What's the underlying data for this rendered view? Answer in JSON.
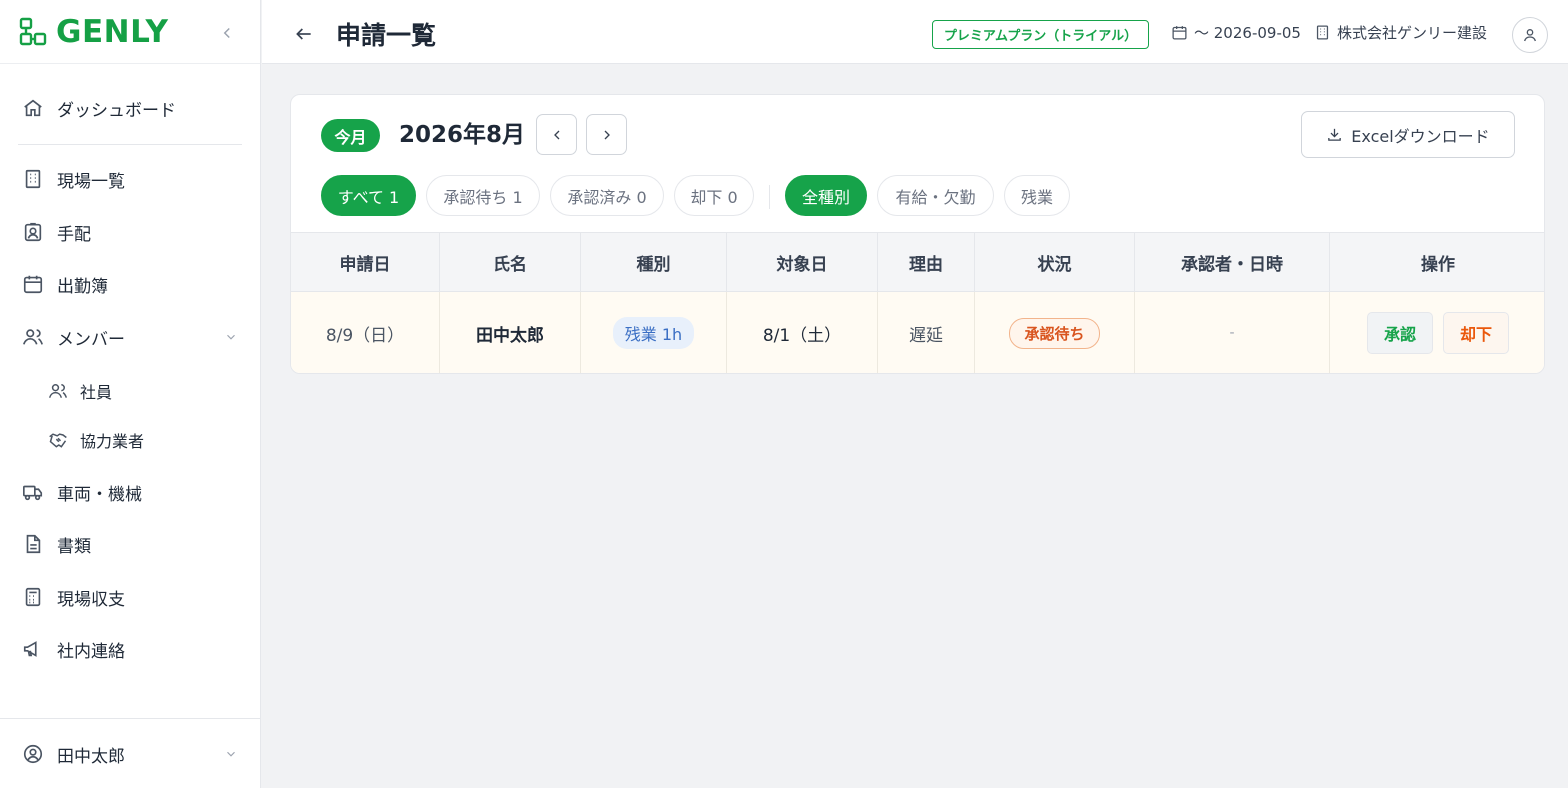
{
  "app": {
    "logo_text": "GENLY"
  },
  "sidebar": {
    "items": [
      {
        "label": "ダッシュボード",
        "icon": "home-icon"
      },
      {
        "label": "現場一覧",
        "icon": "building-icon"
      },
      {
        "label": "手配",
        "icon": "user-badge-icon"
      },
      {
        "label": "出勤簿",
        "icon": "calendar-icon"
      },
      {
        "label": "メンバー",
        "icon": "users-icon"
      },
      {
        "label": "社員",
        "icon": "users-icon"
      },
      {
        "label": "協力業者",
        "icon": "handshake-icon"
      },
      {
        "label": "車両・機械",
        "icon": "truck-icon"
      },
      {
        "label": "書類",
        "icon": "file-text-icon"
      },
      {
        "label": "現場収支",
        "icon": "calculator-icon"
      },
      {
        "label": "社内連絡",
        "icon": "megaphone-icon"
      }
    ],
    "footer_user": "田中太郎"
  },
  "header": {
    "title": "申請一覧",
    "plan_badge": "プレミアムプラン（トライアル）",
    "expiry": "〜 2026-09-05",
    "company": "株式会社ゲンリー建設"
  },
  "toolbar": {
    "this_month": "今月",
    "month_label": "2026年8月",
    "excel_button": "Excelダウンロード"
  },
  "status_filters": [
    {
      "label": "すべて 1",
      "active": true
    },
    {
      "label": "承認待ち 1",
      "active": false
    },
    {
      "label": "承認済み 0",
      "active": false
    },
    {
      "label": "却下 0",
      "active": false
    }
  ],
  "type_filters": [
    {
      "label": "全種別",
      "active": true
    },
    {
      "label": "有給・欠勤",
      "active": false
    },
    {
      "label": "残業",
      "active": false
    }
  ],
  "table": {
    "headers": [
      "申請日",
      "氏名",
      "種別",
      "対象日",
      "理由",
      "状況",
      "承認者・日時",
      "操作"
    ],
    "rows": [
      {
        "applied_date": "8/9（日）",
        "name": "田中太郎",
        "type": "残業 1h",
        "target_date": "8/1（土）",
        "reason": "遅延",
        "status": "承認待ち",
        "approver": "-",
        "approve_label": "承認",
        "reject_label": "却下"
      }
    ]
  },
  "colors": {
    "brand": "#16a34a",
    "status_pending": "#d9541e",
    "type_badge": "#3b6fc4"
  }
}
